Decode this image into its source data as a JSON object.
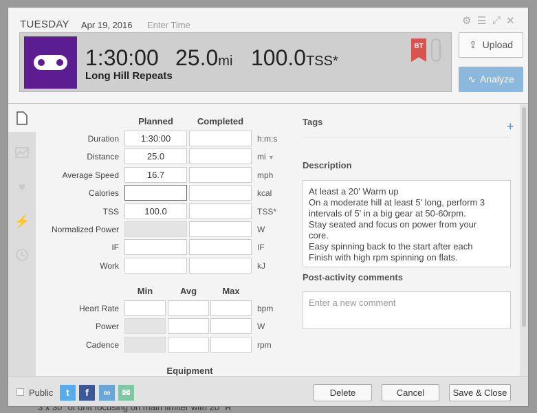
{
  "background": {
    "text": "3 x 30\" of unit focusing on main limiter with 20\" R"
  },
  "header": {
    "day": "TUESDAY",
    "date": "Apr 19, 2016",
    "time_placeholder": "Enter Time",
    "duration": "1:30:00",
    "distance": "25.0",
    "distance_unit": "mi",
    "tss": "100.0",
    "tss_unit": "TSS*",
    "title": "Long Hill Repeats",
    "badge": "BT",
    "upload_label": "Upload",
    "analyze_label": "Analyze",
    "icons": [
      "gear-icon",
      "menu-icon",
      "expand-icon",
      "close-icon"
    ],
    "sport_icon": "bike-chain-icon",
    "sport_color": "#5b1d91"
  },
  "sidebar": {
    "tabs": [
      "document-icon",
      "chart-icon",
      "heart-icon",
      "bolt-icon",
      "clock-icon"
    ]
  },
  "metrics": {
    "planned_header": "Planned",
    "completed_header": "Completed",
    "rows": [
      {
        "label": "Duration",
        "planned": "1:30:00",
        "completed": "",
        "unit": "h:m:s"
      },
      {
        "label": "Distance",
        "planned": "25.0",
        "completed": "",
        "unit": "mi"
      },
      {
        "label": "Average Speed",
        "planned": "16.7",
        "completed": "",
        "unit": "mph"
      },
      {
        "label": "Calories",
        "planned": "",
        "completed": "",
        "unit": "kcal"
      },
      {
        "label": "TSS",
        "planned": "100.0",
        "completed": "",
        "unit": "TSS*"
      },
      {
        "label": "Normalized Power",
        "planned": "",
        "completed": "",
        "unit": "W"
      },
      {
        "label": "IF",
        "planned": "",
        "completed": "",
        "unit": "IF"
      },
      {
        "label": "Work",
        "planned": "",
        "completed": "",
        "unit": "kJ"
      }
    ]
  },
  "ranges": {
    "min_header": "Min",
    "avg_header": "Avg",
    "max_header": "Max",
    "rows": [
      {
        "label": "Heart Rate",
        "min": "",
        "avg": "",
        "max": "",
        "unit": "bpm"
      },
      {
        "label": "Power",
        "min": "",
        "avg": "",
        "max": "",
        "unit": "W"
      },
      {
        "label": "Cadence",
        "min": "",
        "avg": "",
        "max": "",
        "unit": "rpm"
      }
    ]
  },
  "equipment_label": "Equipment",
  "tags_label": "Tags",
  "description": {
    "label": "Description",
    "lines": [
      "At least a 20' Warm up",
      "On a moderate hill at least 5' long, perform 3",
      "intervals of 5' in a big gear at 50-60rpm.",
      "Stay seated and focus on power from your",
      "core.",
      "Easy spinning back to the start after each",
      "Finish with high rpm spinning on flats."
    ]
  },
  "comments": {
    "label": "Post-activity comments",
    "placeholder": "Enter a new comment"
  },
  "footer": {
    "public_label": "Public",
    "share": [
      {
        "icon": "twitter-icon",
        "glyph": "t",
        "color": "#55acee"
      },
      {
        "icon": "facebook-icon",
        "glyph": "f",
        "color": "#3b5998"
      },
      {
        "icon": "link-icon",
        "glyph": "∞",
        "color": "#6aa6d8"
      },
      {
        "icon": "email-icon",
        "glyph": "✉",
        "color": "#7fc7a5"
      }
    ],
    "delete_label": "Delete",
    "cancel_label": "Cancel",
    "save_label": "Save & Close"
  }
}
